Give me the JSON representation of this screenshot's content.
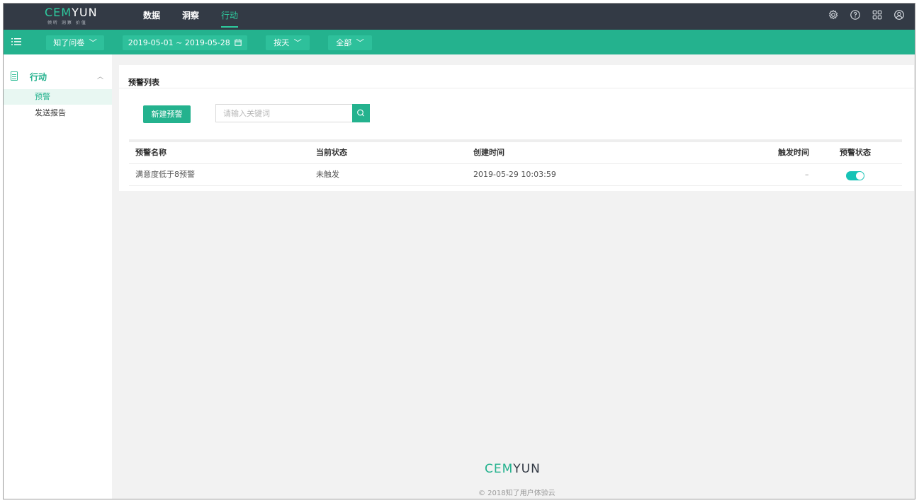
{
  "app": {
    "logo_main_accent": "CEM",
    "logo_y": "Y",
    "logo_main_rest": "UN",
    "logo_sub": "倾听 洞察 价值"
  },
  "nav": {
    "items": [
      {
        "label": "数据"
      },
      {
        "label": "洞察"
      },
      {
        "label": "行动"
      }
    ],
    "active_index": 2
  },
  "top_icons": [
    "settings-gear-icon",
    "help-icon",
    "apps-grid-icon",
    "user-account-icon"
  ],
  "filters": {
    "survey": "知了问卷",
    "date_range": "2019-05-01 ~ 2019-05-28",
    "granularity": "按天",
    "scope": "全部"
  },
  "sidebar": {
    "section_label": "行动",
    "items": [
      {
        "label": "预警",
        "active": true
      },
      {
        "label": "发送报告",
        "active": false
      }
    ]
  },
  "main": {
    "card_title": "预警列表",
    "new_button": "新建预警",
    "search_placeholder": "请输入关键词",
    "table": {
      "headers": [
        "预警名称",
        "当前状态",
        "创建时间",
        "触发时间",
        "预警状态"
      ],
      "rows": [
        {
          "name": "满意度低于8预警",
          "status": "未触发",
          "created": "2019-05-29 10:03:59",
          "triggered": "–",
          "enabled": true
        }
      ]
    }
  },
  "footer": {
    "logo_accent": "CEM",
    "logo_y": "Y",
    "logo_rest": "UN",
    "copyright": "© 2018知了用户体验云"
  },
  "colors": {
    "topbar": "#333a45",
    "brand_green": "#24b28e",
    "accent_green": "#2ecc9f",
    "toggle_on": "#17c3b6"
  }
}
